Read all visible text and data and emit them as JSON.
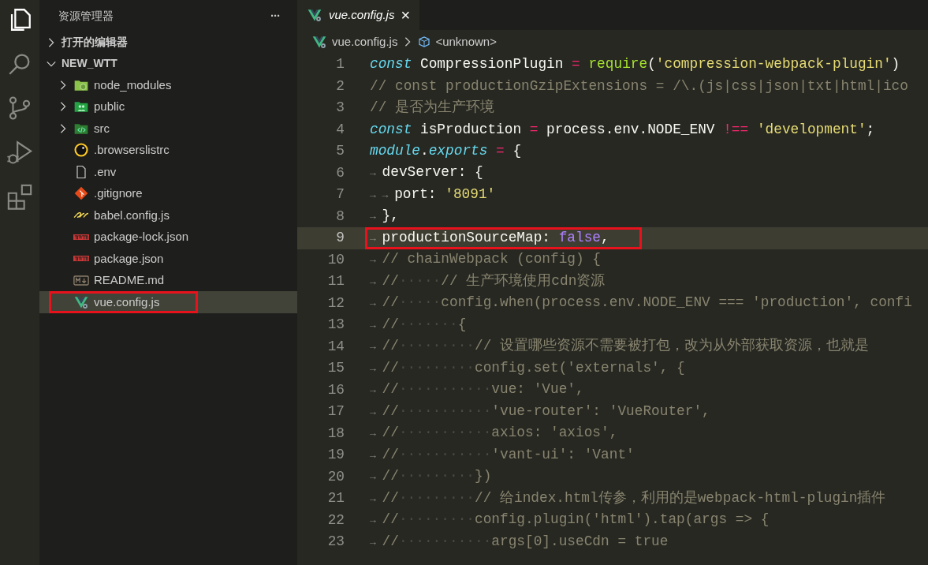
{
  "activity_bar": [
    {
      "kind": "files",
      "selected": true
    },
    {
      "kind": "search",
      "selected": false
    },
    {
      "kind": "source-control",
      "selected": false
    },
    {
      "kind": "run-debug",
      "selected": false
    },
    {
      "kind": "extensions",
      "selected": false
    }
  ],
  "explorer": {
    "title": "资源管理器",
    "more": "···",
    "sections": [
      {
        "label": "打开的编辑器",
        "expanded": false
      },
      {
        "label": "NEW_WTT",
        "expanded": true,
        "items": [
          {
            "name": "node_modules",
            "kind": "folder-node",
            "expanded": false,
            "selected": false,
            "annotated": false
          },
          {
            "name": "public",
            "kind": "folder-public",
            "expanded": false,
            "selected": false,
            "annotated": false
          },
          {
            "name": "src",
            "kind": "folder-src",
            "expanded": false,
            "selected": false,
            "annotated": false
          },
          {
            "name": ".browserslistrc",
            "kind": "browserslist",
            "selected": false,
            "annotated": false
          },
          {
            "name": ".env",
            "kind": "file",
            "selected": false,
            "annotated": false
          },
          {
            "name": ".gitignore",
            "kind": "git",
            "selected": false,
            "annotated": false
          },
          {
            "name": "babel.config.js",
            "kind": "babel",
            "selected": false,
            "annotated": false
          },
          {
            "name": "package-lock.json",
            "kind": "npm",
            "selected": false,
            "annotated": false
          },
          {
            "name": "package.json",
            "kind": "npm",
            "selected": false,
            "annotated": false
          },
          {
            "name": "README.md",
            "kind": "markdown",
            "selected": false,
            "annotated": false
          },
          {
            "name": "vue.config.js",
            "kind": "vue",
            "selected": true,
            "annotated": true
          }
        ]
      }
    ]
  },
  "tabs": [
    {
      "label": "vue.config.js",
      "selected": true,
      "close": "×"
    }
  ],
  "breadcrumb": [
    {
      "label": "vue.config.js",
      "kind": "vue"
    },
    {
      "label": "<unknown>",
      "kind": "symbol"
    }
  ],
  "code_lines": [
    {
      "number": "1",
      "current": false,
      "annotated": false,
      "tokens": [
        {
          "kind": "kw",
          "text": "const"
        },
        {
          "kind": "p",
          "text": " CompressionPlugin "
        },
        {
          "kind": "op",
          "text": "= "
        },
        {
          "kind": "fn",
          "text": "require"
        },
        {
          "kind": "p",
          "text": "("
        },
        {
          "kind": "str",
          "text": "'compression-webpack-plugin'"
        },
        {
          "kind": "p",
          "text": ")"
        }
      ]
    },
    {
      "number": "2",
      "current": false,
      "annotated": false,
      "tokens": [
        {
          "kind": "cm",
          "text": "// const productionGzipExtensions = /\\.(js|css|json|txt|html|ico"
        }
      ]
    },
    {
      "number": "3",
      "current": false,
      "annotated": false,
      "tokens": [
        {
          "kind": "cm",
          "text": "// 是否为生产环境"
        }
      ]
    },
    {
      "number": "4",
      "current": false,
      "annotated": false,
      "tokens": [
        {
          "kind": "kw",
          "text": "const"
        },
        {
          "kind": "p",
          "text": " isProduction "
        },
        {
          "kind": "op",
          "text": "="
        },
        {
          "kind": "p",
          "text": " process.env.NODE_ENV "
        },
        {
          "kind": "op",
          "text": "!== "
        },
        {
          "kind": "str",
          "text": "'development'"
        },
        {
          "kind": "p",
          "text": ";"
        }
      ]
    },
    {
      "number": "5",
      "current": false,
      "annotated": false,
      "tokens": [
        {
          "kind": "kw",
          "text": "module"
        },
        {
          "kind": "p",
          "text": "."
        },
        {
          "kind": "kw",
          "text": "exports"
        },
        {
          "kind": "op",
          "text": " = "
        },
        {
          "kind": "p",
          "text": "{"
        }
      ]
    },
    {
      "number": "6",
      "current": false,
      "annotated": false,
      "tokens": [
        {
          "kind": "tab",
          "text": "→"
        },
        {
          "kind": "p",
          "text": "devServer: {"
        }
      ]
    },
    {
      "number": "7",
      "current": false,
      "annotated": false,
      "tokens": [
        {
          "kind": "tab",
          "text": "→"
        },
        {
          "kind": "tab",
          "text": "→"
        },
        {
          "kind": "p",
          "text": "port: "
        },
        {
          "kind": "str",
          "text": "'8091'"
        }
      ]
    },
    {
      "number": "8",
      "current": false,
      "annotated": false,
      "tokens": [
        {
          "kind": "tab",
          "text": "→"
        },
        {
          "kind": "p",
          "text": "},"
        }
      ]
    },
    {
      "number": "9",
      "current": true,
      "annotated": true,
      "tokens": [
        {
          "kind": "tab",
          "text": "→"
        },
        {
          "kind": "p",
          "text": "productionSourceMap: "
        },
        {
          "kind": "num",
          "text": "false"
        },
        {
          "kind": "p",
          "text": ","
        }
      ]
    },
    {
      "number": "10",
      "current": false,
      "annotated": false,
      "tokens": [
        {
          "kind": "tab",
          "text": "→"
        },
        {
          "kind": "cm",
          "text": "// chainWebpack (config) {"
        }
      ]
    },
    {
      "number": "11",
      "current": false,
      "annotated": false,
      "tokens": [
        {
          "kind": "tab",
          "text": "→"
        },
        {
          "kind": "cm",
          "text": "//"
        },
        {
          "kind": "sp",
          "text": "·····"
        },
        {
          "kind": "cm",
          "text": "// 生产环境使用cdn资源"
        }
      ]
    },
    {
      "number": "12",
      "current": false,
      "annotated": false,
      "tokens": [
        {
          "kind": "tab",
          "text": "→"
        },
        {
          "kind": "cm",
          "text": "//"
        },
        {
          "kind": "sp",
          "text": "·····"
        },
        {
          "kind": "cm",
          "text": "config.when(process.env.NODE_ENV === 'production', confi"
        }
      ]
    },
    {
      "number": "13",
      "current": false,
      "annotated": false,
      "tokens": [
        {
          "kind": "tab",
          "text": "→"
        },
        {
          "kind": "cm",
          "text": "//"
        },
        {
          "kind": "sp",
          "text": "·······"
        },
        {
          "kind": "cm",
          "text": "{"
        }
      ]
    },
    {
      "number": "14",
      "current": false,
      "annotated": false,
      "tokens": [
        {
          "kind": "tab",
          "text": "→"
        },
        {
          "kind": "cm",
          "text": "//"
        },
        {
          "kind": "sp",
          "text": "·········"
        },
        {
          "kind": "cm",
          "text": "// 设置哪些资源不需要被打包，改为从外部获取资源，也就是"
        }
      ]
    },
    {
      "number": "15",
      "current": false,
      "annotated": false,
      "tokens": [
        {
          "kind": "tab",
          "text": "→"
        },
        {
          "kind": "cm",
          "text": "//"
        },
        {
          "kind": "sp",
          "text": "·········"
        },
        {
          "kind": "cm",
          "text": "config.set('externals', {"
        }
      ]
    },
    {
      "number": "16",
      "current": false,
      "annotated": false,
      "tokens": [
        {
          "kind": "tab",
          "text": "→"
        },
        {
          "kind": "cm",
          "text": "//"
        },
        {
          "kind": "sp",
          "text": "···········"
        },
        {
          "kind": "cm",
          "text": "vue: 'Vue',"
        }
      ]
    },
    {
      "number": "17",
      "current": false,
      "annotated": false,
      "tokens": [
        {
          "kind": "tab",
          "text": "→"
        },
        {
          "kind": "cm",
          "text": "//"
        },
        {
          "kind": "sp",
          "text": "···········"
        },
        {
          "kind": "cm",
          "text": "'vue-router': 'VueRouter',"
        }
      ]
    },
    {
      "number": "18",
      "current": false,
      "annotated": false,
      "tokens": [
        {
          "kind": "tab",
          "text": "→"
        },
        {
          "kind": "cm",
          "text": "//"
        },
        {
          "kind": "sp",
          "text": "···········"
        },
        {
          "kind": "cm",
          "text": "axios: 'axios',"
        }
      ]
    },
    {
      "number": "19",
      "current": false,
      "annotated": false,
      "tokens": [
        {
          "kind": "tab",
          "text": "→"
        },
        {
          "kind": "cm",
          "text": "//"
        },
        {
          "kind": "sp",
          "text": "···········"
        },
        {
          "kind": "cm",
          "text": "'vant-ui': 'Vant'"
        }
      ]
    },
    {
      "number": "20",
      "current": false,
      "annotated": false,
      "tokens": [
        {
          "kind": "tab",
          "text": "→"
        },
        {
          "kind": "cm",
          "text": "//"
        },
        {
          "kind": "sp",
          "text": "·········"
        },
        {
          "kind": "cm",
          "text": "})"
        }
      ]
    },
    {
      "number": "21",
      "current": false,
      "annotated": false,
      "tokens": [
        {
          "kind": "tab",
          "text": "→"
        },
        {
          "kind": "cm",
          "text": "//"
        },
        {
          "kind": "sp",
          "text": "·········"
        },
        {
          "kind": "cm",
          "text": "// 给index.html传参，利用的是webpack-html-plugin插件"
        }
      ]
    },
    {
      "number": "22",
      "current": false,
      "annotated": false,
      "tokens": [
        {
          "kind": "tab",
          "text": "→"
        },
        {
          "kind": "cm",
          "text": "//"
        },
        {
          "kind": "sp",
          "text": "·········"
        },
        {
          "kind": "cm",
          "text": "config.plugin('html').tap(args => {"
        }
      ]
    },
    {
      "number": "23",
      "current": false,
      "annotated": false,
      "tokens": [
        {
          "kind": "tab",
          "text": "→"
        },
        {
          "kind": "cm",
          "text": "//"
        },
        {
          "kind": "sp",
          "text": "···········"
        },
        {
          "kind": "cm",
          "text": "args[0].useCdn = true"
        }
      ]
    }
  ]
}
